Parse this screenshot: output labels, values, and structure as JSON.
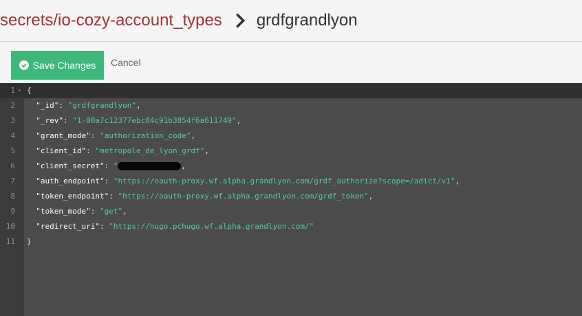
{
  "breadcrumb": {
    "database": "secrets/io-cozy-account_types",
    "document": "grdfgrandlyon"
  },
  "toolbar": {
    "save_label": "Save Changes",
    "cancel_label": "Cancel"
  },
  "editor": {
    "lines": [
      {
        "num": "1",
        "open": "{"
      },
      {
        "num": "2",
        "key": "\"_id\"",
        "value": "\"grdfgrandlyon\"",
        "comma": ","
      },
      {
        "num": "3",
        "key": "\"_rev\"",
        "value": "\"1-00a7c12377ebc04c91b3854f6a611749\"",
        "comma": ","
      },
      {
        "num": "4",
        "key": "\"grant_mode\"",
        "value": "\"authorization_code\"",
        "comma": ","
      },
      {
        "num": "5",
        "key": "\"client_id\"",
        "value": "\"metropole_de_lyon_grdf\"",
        "comma": ","
      },
      {
        "num": "6",
        "key": "\"client_secret\"",
        "value": "\"",
        "comma": ","
      },
      {
        "num": "7",
        "key": "\"auth_endpoint\"",
        "value": "\"https://oauth-proxy.wf.alpha.grandlyon.com/grdf_authorize?scope=/adict/v1\"",
        "comma": ","
      },
      {
        "num": "8",
        "key": "\"token_endpoint\"",
        "value": "\"https://oauth-proxy.wf.alpha.grandlyon.com/grdf_token\"",
        "comma": ","
      },
      {
        "num": "9",
        "key": "\"token_mode\"",
        "value": "\"get\"",
        "comma": ","
      },
      {
        "num": "10",
        "key": "\"redirect_uri\"",
        "value": "\"https://hugo.pchugo.wf.alpha.grandlyon.com/\"",
        "comma": ""
      },
      {
        "num": "11",
        "close": "}"
      }
    ]
  }
}
